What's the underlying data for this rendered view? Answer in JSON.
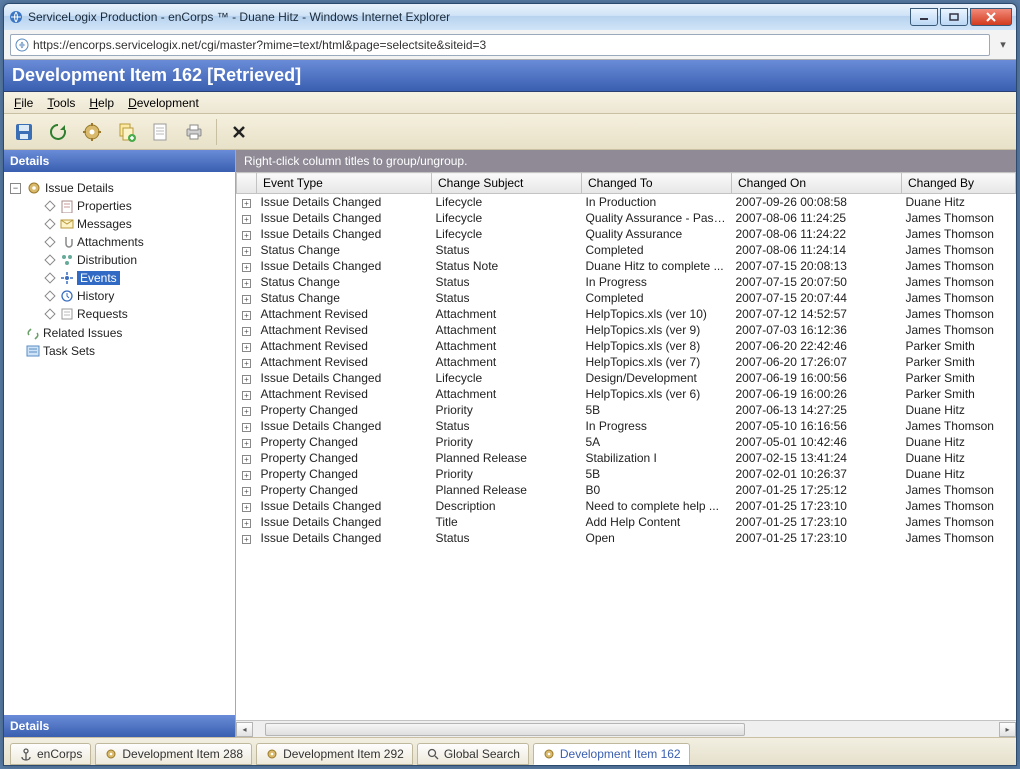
{
  "window": {
    "title": "ServiceLogix Production - enCorps ™ - Duane Hitz - Windows Internet Explorer",
    "url": "https://encorps.servicelogix.net/cgi/master?mime=text/html&page=selectsite&siteid=3"
  },
  "app": {
    "header": "Development Item 162 [Retrieved]",
    "hint": "Right-click column titles to group/ungroup."
  },
  "menu": {
    "file": "File",
    "tools": "Tools",
    "help": "Help",
    "development": "Development"
  },
  "sidebar": {
    "title_top": "Details",
    "title_bottom": "Details",
    "root": "Issue Details",
    "items": [
      "Properties",
      "Messages",
      "Attachments",
      "Distribution",
      "Events",
      "History",
      "Requests"
    ],
    "extra": [
      "Related Issues",
      "Task Sets"
    ]
  },
  "columns": [
    "",
    "Event Type",
    "Change Subject",
    "Changed To",
    "Changed On",
    "Changed By"
  ],
  "rows": [
    {
      "type": "Issue Details Changed",
      "subject": "Lifecycle",
      "to": "In Production",
      "on": "2007-09-26 00:08:58",
      "by": "Duane Hitz"
    },
    {
      "type": "Issue Details Changed",
      "subject": "Lifecycle",
      "to": "Quality Assurance - Passed",
      "on": "2007-08-06 11:24:25",
      "by": "James Thomson"
    },
    {
      "type": "Issue Details Changed",
      "subject": "Lifecycle",
      "to": "Quality Assurance",
      "on": "2007-08-06 11:24:22",
      "by": "James Thomson"
    },
    {
      "type": "Status Change",
      "subject": "Status",
      "to": "Completed",
      "on": "2007-08-06 11:24:14",
      "by": "James Thomson"
    },
    {
      "type": "Issue Details Changed",
      "subject": "Status Note",
      "to": "Duane Hitz to complete ...",
      "on": "2007-07-15 20:08:13",
      "by": "James Thomson"
    },
    {
      "type": "Status Change",
      "subject": "Status",
      "to": "In Progress",
      "on": "2007-07-15 20:07:50",
      "by": "James Thomson"
    },
    {
      "type": "Status Change",
      "subject": "Status",
      "to": "Completed",
      "on": "2007-07-15 20:07:44",
      "by": "James Thomson"
    },
    {
      "type": "Attachment Revised",
      "subject": "Attachment",
      "to": "HelpTopics.xls (ver 10)",
      "on": "2007-07-12 14:52:57",
      "by": "James Thomson"
    },
    {
      "type": "Attachment Revised",
      "subject": "Attachment",
      "to": "HelpTopics.xls (ver 9)",
      "on": "2007-07-03 16:12:36",
      "by": "James Thomson"
    },
    {
      "type": "Attachment Revised",
      "subject": "Attachment",
      "to": "HelpTopics.xls (ver 8)",
      "on": "2007-06-20 22:42:46",
      "by": "Parker Smith"
    },
    {
      "type": "Attachment Revised",
      "subject": "Attachment",
      "to": "HelpTopics.xls (ver 7)",
      "on": "2007-06-20 17:26:07",
      "by": "Parker Smith"
    },
    {
      "type": "Issue Details Changed",
      "subject": "Lifecycle",
      "to": "Design/Development",
      "on": "2007-06-19 16:00:56",
      "by": "Parker Smith"
    },
    {
      "type": "Attachment Revised",
      "subject": "Attachment",
      "to": "HelpTopics.xls (ver 6)",
      "on": "2007-06-19 16:00:26",
      "by": "Parker Smith"
    },
    {
      "type": "Property Changed",
      "subject": "Priority",
      "to": "5B",
      "on": "2007-06-13 14:27:25",
      "by": "Duane Hitz"
    },
    {
      "type": "Issue Details Changed",
      "subject": "Status",
      "to": "In Progress",
      "on": "2007-05-10 16:16:56",
      "by": "James Thomson"
    },
    {
      "type": "Property Changed",
      "subject": "Priority",
      "to": "5A",
      "on": "2007-05-01 10:42:46",
      "by": "Duane Hitz"
    },
    {
      "type": "Property Changed",
      "subject": "Planned Release",
      "to": "Stabilization I",
      "on": "2007-02-15 13:41:24",
      "by": "Duane Hitz"
    },
    {
      "type": "Property Changed",
      "subject": "Priority",
      "to": "5B",
      "on": "2007-02-01 10:26:37",
      "by": "Duane Hitz"
    },
    {
      "type": "Property Changed",
      "subject": "Planned Release",
      "to": "B0",
      "on": "2007-01-25 17:25:12",
      "by": "James Thomson"
    },
    {
      "type": "Issue Details Changed",
      "subject": "Description",
      "to": "Need to complete help ...",
      "on": "2007-01-25 17:23:10",
      "by": "James Thomson"
    },
    {
      "type": "Issue Details Changed",
      "subject": "Title",
      "to": "Add Help Content",
      "on": "2007-01-25 17:23:10",
      "by": "James Thomson"
    },
    {
      "type": "Issue Details Changed",
      "subject": "Status",
      "to": "Open",
      "on": "2007-01-25 17:23:10",
      "by": "James Thomson"
    }
  ],
  "tabs": [
    {
      "label": "enCorps",
      "icon": "anchor"
    },
    {
      "label": "Development Item 288",
      "icon": "gear"
    },
    {
      "label": "Development Item 292",
      "icon": "gear"
    },
    {
      "label": "Global Search",
      "icon": "search"
    },
    {
      "label": "Development Item 162",
      "icon": "gear",
      "active": true
    }
  ]
}
